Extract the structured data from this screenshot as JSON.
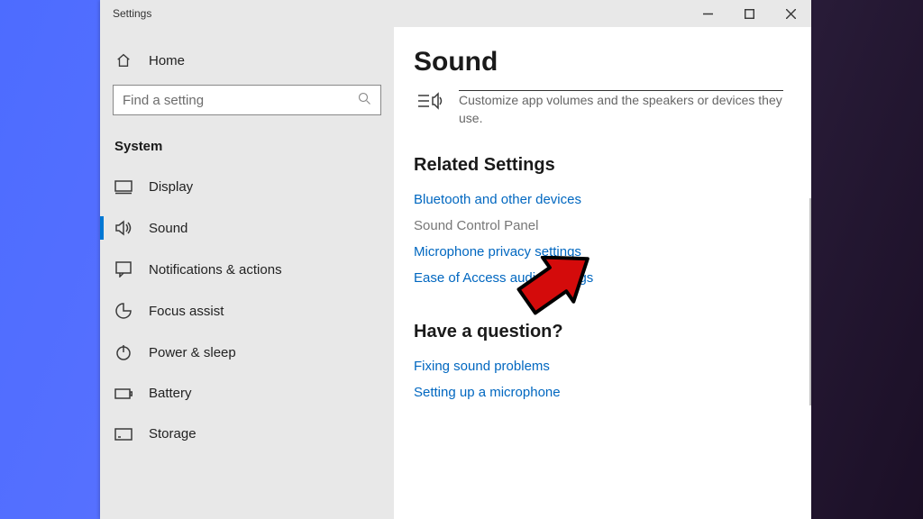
{
  "window": {
    "title": "Settings"
  },
  "sidebar": {
    "home_label": "Home",
    "search_placeholder": "Find a setting",
    "category": "System",
    "items": [
      {
        "label": "Display"
      },
      {
        "label": "Sound"
      },
      {
        "label": "Notifications & actions"
      },
      {
        "label": "Focus assist"
      },
      {
        "label": "Power & sleep"
      },
      {
        "label": "Battery"
      },
      {
        "label": "Storage"
      }
    ],
    "active_index": 1
  },
  "content": {
    "title": "Sound",
    "cutoff_desc": "Customize app volumes and the speakers or devices they use.",
    "related_heading": "Related Settings",
    "related_links": [
      "Bluetooth and other devices",
      "Sound Control Panel",
      "Microphone privacy settings",
      "Ease of Access audio settings"
    ],
    "question_heading": "Have a question?",
    "question_links": [
      "Fixing sound problems",
      "Setting up a microphone"
    ]
  }
}
